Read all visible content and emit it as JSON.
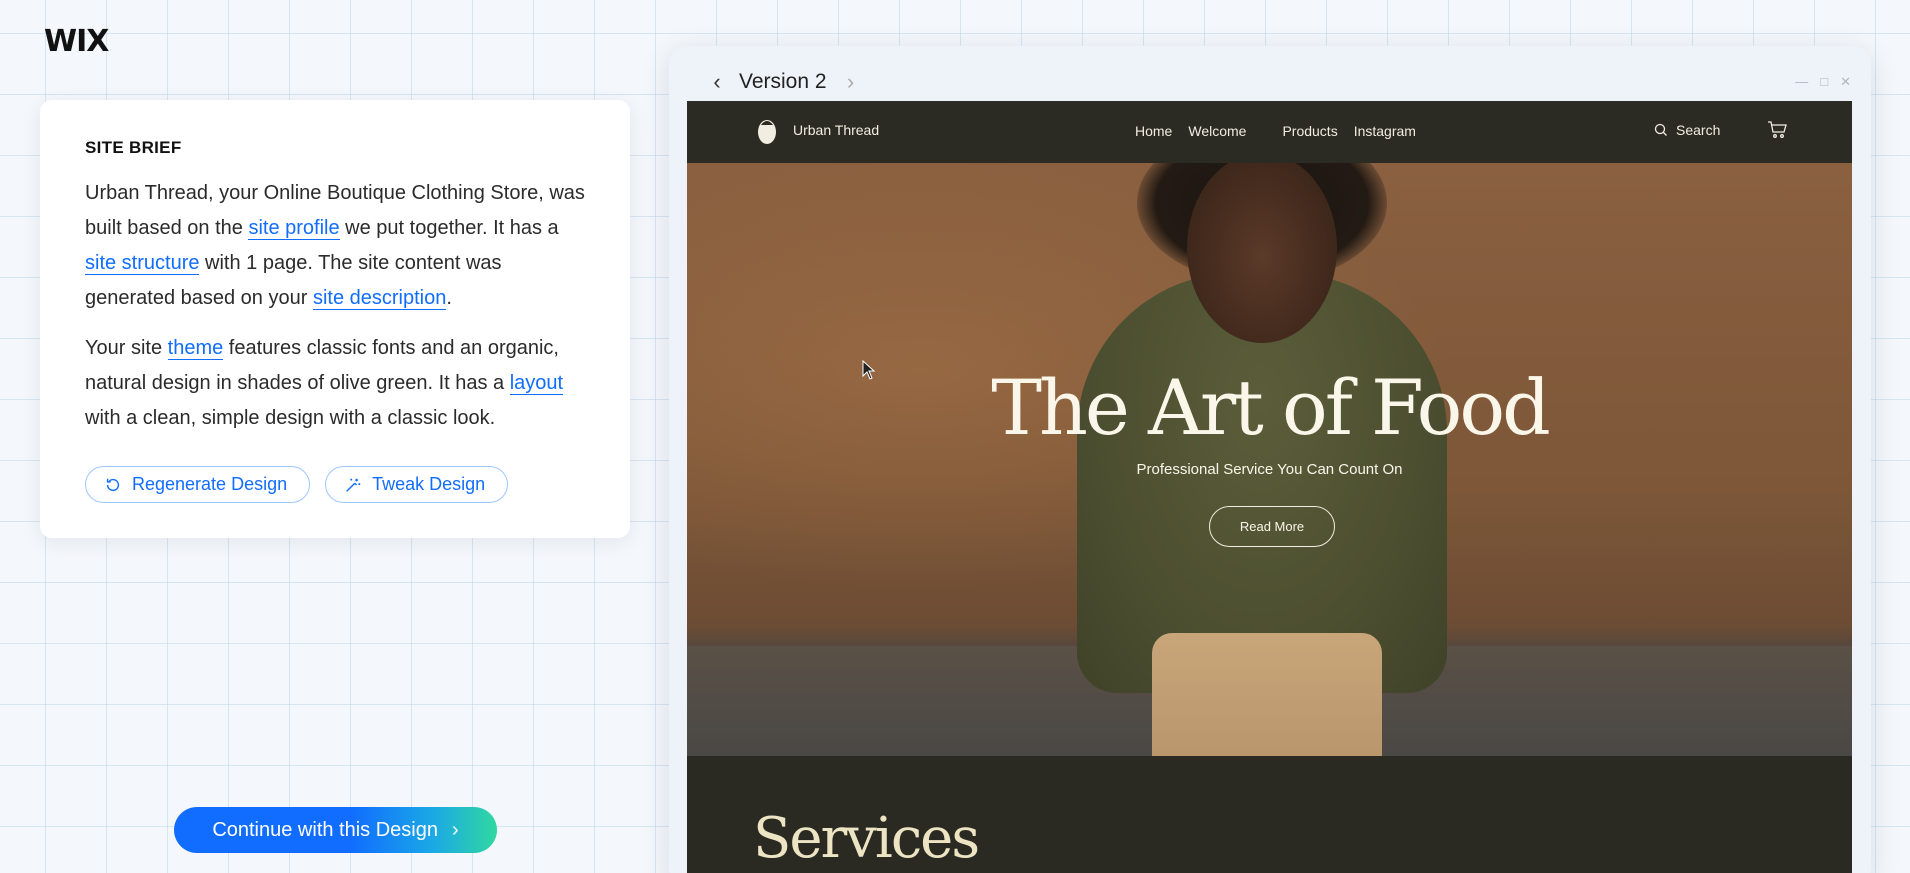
{
  "app": {
    "logo": "WIX"
  },
  "brief": {
    "title": "SITE BRIEF",
    "p1": {
      "a": "Urban Thread, your Online Boutique Clothing Store, was built based on the ",
      "link1": "site profile",
      "b": " we put together. It has a ",
      "link2": "site structure",
      "c": " with 1 page. The site content was generated based on your ",
      "link3": "site description",
      "d": "."
    },
    "p2": {
      "a": "Your site ",
      "link1": "theme",
      "b": " features classic fonts and an organic, natural design in shades of olive green. It has a ",
      "link2": "layout",
      "c": " with a clean, simple design with a classic look."
    },
    "regenerate_label": "Regenerate Design",
    "tweak_label": "Tweak Design"
  },
  "continue_label": "Continue with this Design",
  "preview": {
    "version_label": "Version 2",
    "site": {
      "name": "Urban Thread",
      "nav": [
        "Home",
        "Welcome",
        "Products",
        "Instagram"
      ],
      "search_label": "Search",
      "hero_title": "The Art of Food",
      "hero_subtitle": "Professional Service You Can Count On",
      "hero_button": "Read More",
      "services_title": "Services"
    }
  },
  "colors": {
    "accent": "#116dff",
    "site_dark": "#2c2b23",
    "site_cream": "#f1ede0"
  }
}
